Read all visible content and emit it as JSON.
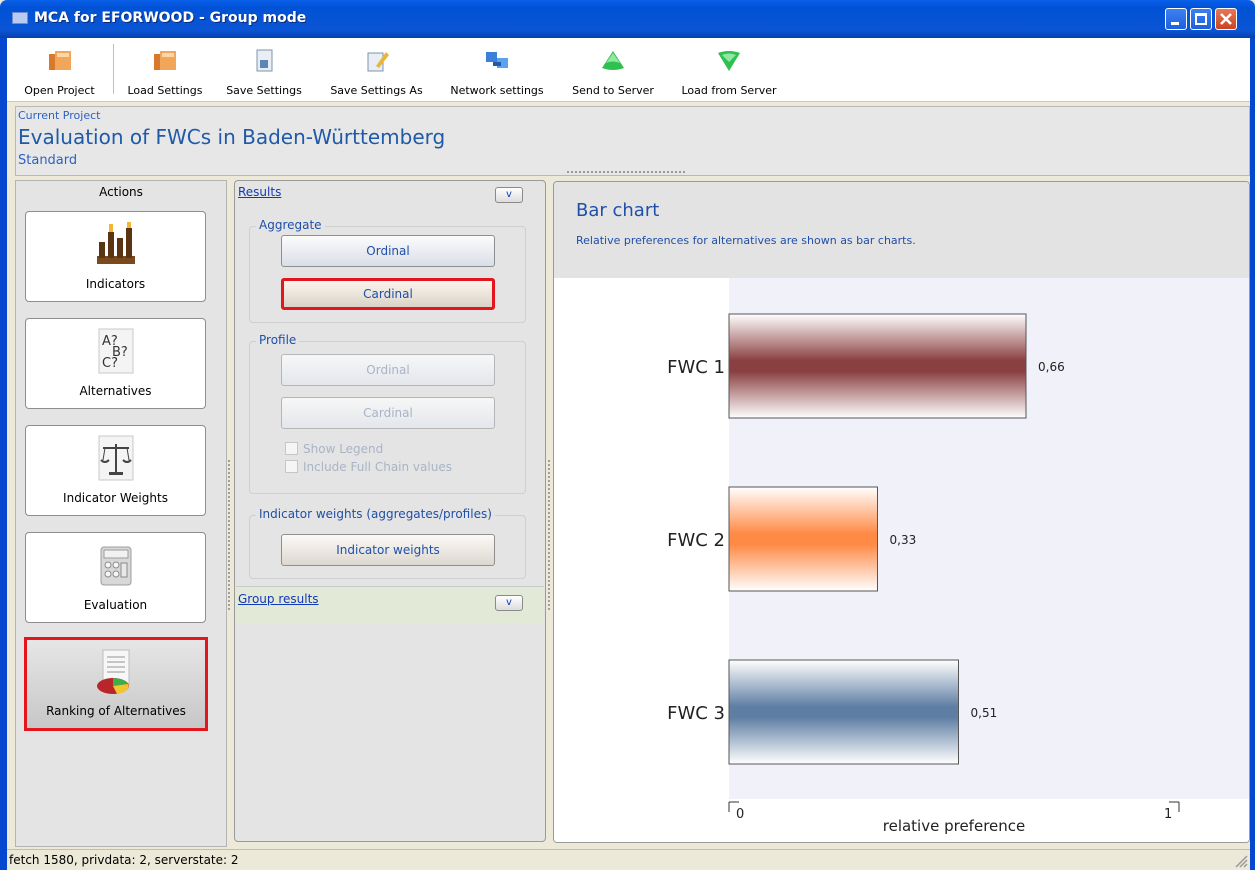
{
  "window": {
    "title": "MCA for EFORWOOD - Group mode"
  },
  "toolbar": {
    "items": [
      {
        "label": "Open Project",
        "icon": "folder-open-icon"
      },
      {
        "label": "Load Settings",
        "icon": "folder-icon"
      },
      {
        "label": "Save Settings",
        "icon": "save-file-icon"
      },
      {
        "label": "Save Settings As",
        "icon": "save-as-icon"
      },
      {
        "label": "Network settings",
        "icon": "network-icon"
      },
      {
        "label": "Send to Server",
        "icon": "green-up-triangle-icon"
      },
      {
        "label": "Load from Server",
        "icon": "green-down-triangle-icon"
      }
    ]
  },
  "project": {
    "caption": "Current Project",
    "name": "Evaluation of FWCs in Baden-Württemberg",
    "variant": "Standard"
  },
  "actions": {
    "heading": "Actions",
    "items": [
      {
        "label": "Indicators",
        "icon": "bar-chart-icon",
        "selected": false
      },
      {
        "label": "Alternatives",
        "icon": "question-letters-icon",
        "selected": false
      },
      {
        "label": "Indicator Weights",
        "icon": "scales-icon",
        "selected": false
      },
      {
        "label": "Evaluation",
        "icon": "calculator-icon",
        "selected": false
      },
      {
        "label": "Ranking of Alternatives",
        "icon": "pie-chart-document-icon",
        "selected": true
      }
    ]
  },
  "results": {
    "section_label": "Results",
    "collapse_label": "v",
    "aggregate": {
      "title": "Aggregate",
      "ordinal_label": "Ordinal",
      "cardinal_label": "Cardinal"
    },
    "profile": {
      "title": "Profile",
      "ordinal_label": "Ordinal",
      "cardinal_label": "Cardinal",
      "show_legend_label": "Show Legend",
      "include_full_chain_label": "Include Full Chain values"
    },
    "weights": {
      "title": "Indicator weights (aggregates/profiles)",
      "button_label": "Indicator weights"
    },
    "group_results_label": "Group results",
    "group_collapse_label": "v"
  },
  "chart_panel": {
    "title": "Bar chart",
    "description": "Relative preferences for alternatives are shown as bar charts."
  },
  "chart_data": {
    "type": "bar",
    "orientation": "horizontal",
    "categories": [
      "FWC 1",
      "FWC 2",
      "FWC 3"
    ],
    "values": [
      0.66,
      0.33,
      0.51
    ],
    "value_labels": [
      "0,66",
      "0,33",
      "0,51"
    ],
    "colors": [
      "#8A3F40",
      "#FF8A45",
      "#5E7EA3"
    ],
    "xlabel": "relative preference",
    "xlim": [
      0,
      1
    ],
    "tick_labels": [
      "0",
      "1"
    ]
  },
  "status": {
    "text": "fetch 1580, privdata: 2, serverstate: 2"
  }
}
